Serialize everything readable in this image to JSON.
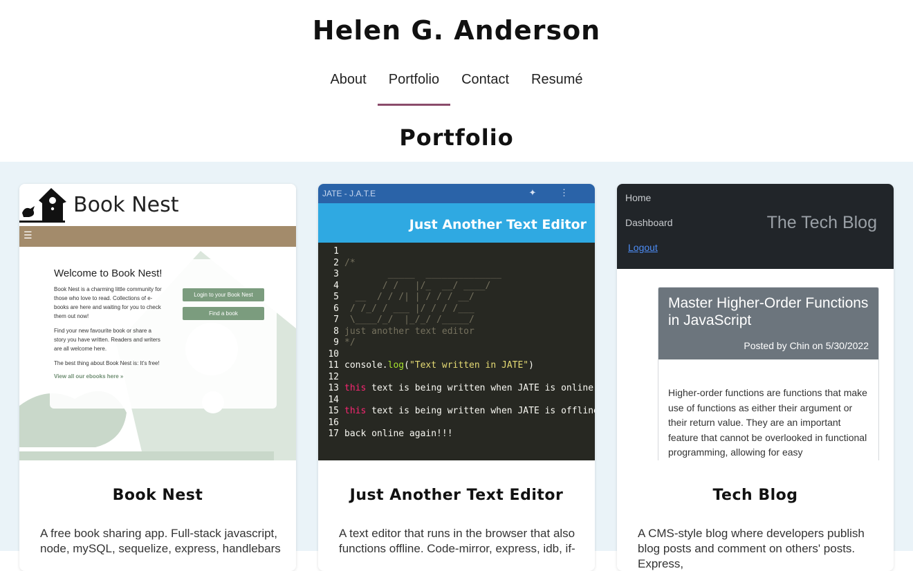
{
  "header": {
    "name": "Helen G. Anderson",
    "nav": [
      "About",
      "Portfolio",
      "Contact",
      "Resumé"
    ],
    "active_nav": "Portfolio",
    "section_title": "Portfolio"
  },
  "projects": [
    {
      "title": "Book Nest",
      "description": "A free book sharing app. Full-stack javascript, node, mySQL, sequelize, express, handlebars",
      "preview": {
        "brand": "Book Nest",
        "menu_icon": "hamburger-icon",
        "welcome": "Welcome to Book Nest!",
        "paragraphs": [
          "Book Nest is a charming little community for those who love to read. Collections of e-books are here and waiting for you to check them out now!",
          "Find your new favourite book or share a story you have written. Readers and writers are all welcome here.",
          "The best thing about Book Nest is: It's free!"
        ],
        "link": "View all our ebooks here »",
        "buttons": [
          "Login to your Book Nest",
          "Find a book"
        ]
      }
    },
    {
      "title": "Just Another Text Editor",
      "description": "A text editor that runs in the browser that also functions offline. Code-mirror, express, idb, if-",
      "preview": {
        "window_title": "JATE - J.A.T.E",
        "app_heading": "Just Another Text Editor",
        "code_lines": [
          {
            "n": "1",
            "html": ""
          },
          {
            "n": "2",
            "html": "<span class='cm'>/*</span>"
          },
          {
            "n": "3",
            "html": "<span class='cm'>        _____  ______________</span>"
          },
          {
            "n": "4",
            "html": "<span class='cm'>       / /   |/_  __/ ____/</span>"
          },
          {
            "n": "5",
            "html": "<span class='cm'>  __  / / /| | / / / __/</span>"
          },
          {
            "n": "6",
            "html": "<span class='cm'> / /_/ / ___ |/ / / /___</span>"
          },
          {
            "n": "7",
            "html": "<span class='cm'> \\____/_/  |_/_/ /_____/</span>"
          },
          {
            "n": "8",
            "html": "<span class='cm'>just another text editor</span>"
          },
          {
            "n": "9",
            "html": "<span class='cm'>*/</span>"
          },
          {
            "n": "10",
            "html": ""
          },
          {
            "n": "11",
            "html": "console.<span class='fn'>log</span>(<span class='str'>\"Text written in JATE\"</span>)"
          },
          {
            "n": "12",
            "html": ""
          },
          {
            "n": "13",
            "html": "<span class='kw'>this</span> text is being written when JATE is online"
          },
          {
            "n": "14",
            "html": ""
          },
          {
            "n": "15",
            "html": "<span class='kw'>this</span> text is being written when JATE is offline"
          },
          {
            "n": "16",
            "html": ""
          },
          {
            "n": "17",
            "html": "back online again!!!"
          }
        ]
      }
    },
    {
      "title": "Tech Blog",
      "description": "A CMS-style blog where developers publish blog posts and comment on others' posts. Express,",
      "preview": {
        "nav_links": [
          "Home",
          "Dashboard"
        ],
        "logout": "Logout",
        "brand": "The Tech Blog",
        "post_title": "Master Higher-Order Functions in JavaScript",
        "post_meta": "Posted by Chin on 5/30/2022",
        "post_body": "Higher-order functions are functions that make use of functions as either their argument or their return value. They are an important feature that cannot be overlooked in functional programming, allowing for easy"
      }
    }
  ],
  "colors": {
    "accent_underline": "#8a4b6a",
    "portfolio_bg": "#eaf3f8",
    "booknest_bar": "#a38b6b",
    "jate_top": "#2a63a8",
    "jate_header": "#2fa9e2",
    "jate_code_bg": "#272822",
    "techblog_nav": "#212529"
  }
}
